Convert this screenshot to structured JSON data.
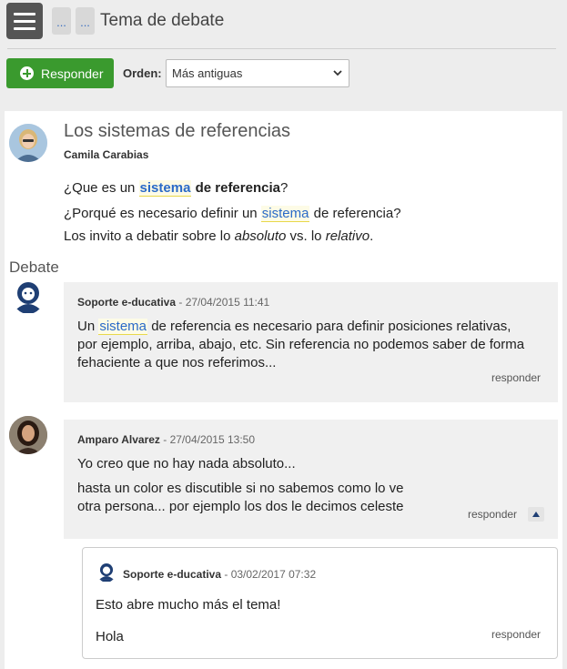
{
  "header": {
    "crumb1": "...",
    "crumb2": "...",
    "title": "Tema de debate"
  },
  "toolbar": {
    "reply_label": "Responder",
    "order_label": "Orden:",
    "order_value": "Más antiguas"
  },
  "post": {
    "title": "Los sistemas de referencias",
    "author": "Camila Carabias",
    "line1_pre": "¿Que es un ",
    "line1_hl": "sistema",
    "line1_bold": " de referencia",
    "line1_post": "?",
    "line2_pre": "¿Porqué es necesario definir un ",
    "line2_hl": "sistema",
    "line2_post": " de referencia?",
    "line3_pre": "Los invito a debatir sobre lo ",
    "line3_em1": "absoluto",
    "line3_mid": " vs. lo ",
    "line3_em2": "relativo",
    "line3_post": "."
  },
  "debate_label": "Debate",
  "replies": [
    {
      "author": "Soporte e-ducativa",
      "date": " - 27/04/2015 11:41",
      "l1_pre": "Un ",
      "l1_hl": "sistema",
      "l1_post": " de referencia es necesario para definir posiciones relativas,",
      "l2": "por ejemplo, arriba, abajo, etc. Sin referencia no podemos saber de forma",
      "l3": "fehaciente a que nos referimos...",
      "reply_link": "responder"
    },
    {
      "author": "Amparo Alvarez",
      "date": " - 27/04/2015 13:50",
      "l1": "Yo creo que no hay nada absoluto...",
      "l2": "hasta un color es discutible si no sabemos como lo ve",
      "l3": "otra persona... por ejemplo los dos le decimos celeste",
      "reply_link": "responder"
    },
    {
      "author": "Soporte e-ducativa",
      "date": " - 03/02/2017 07:32",
      "l1": "Esto abre mucho más el tema!",
      "l2": "Hola",
      "reply_link": "responder"
    }
  ],
  "icons": {
    "menu": "hamburger-menu-icon",
    "reply": "plus-circle-icon",
    "select": "chevron-down-icon",
    "collapse": "triangle-up-icon"
  },
  "colors": {
    "accent_green": "#3a9a2e",
    "highlight_text": "#2a6ac8",
    "highlight_underline": "#e8d84a"
  }
}
